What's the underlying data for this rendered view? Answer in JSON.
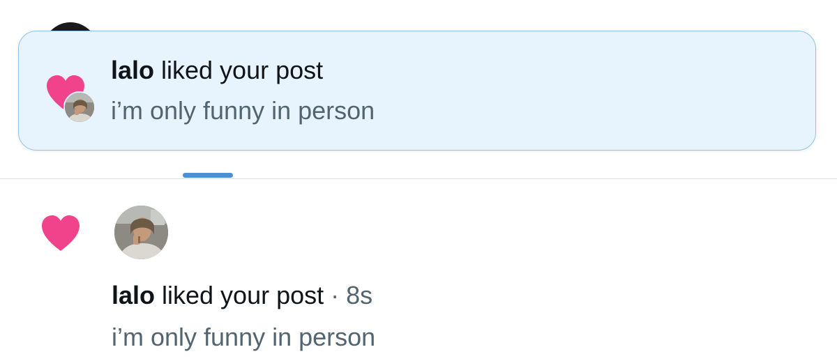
{
  "colors": {
    "heart": "#f0438b",
    "toast_background": "#e8f4fd",
    "toast_border": "#8ec6ea",
    "tab_indicator": "#4a90d9",
    "secondary_text": "#536471",
    "primary_text": "#0f1419"
  },
  "toast": {
    "icon": "heart-icon",
    "user_name": "lalo",
    "action_text": " liked your post",
    "post_text": "i’m only funny in person"
  },
  "notification": {
    "icon": "heart-icon",
    "user_name": "lalo",
    "action_text": " liked your post",
    "separator": " · ",
    "timestamp": "8s",
    "post_text": "i’m only funny in person"
  }
}
